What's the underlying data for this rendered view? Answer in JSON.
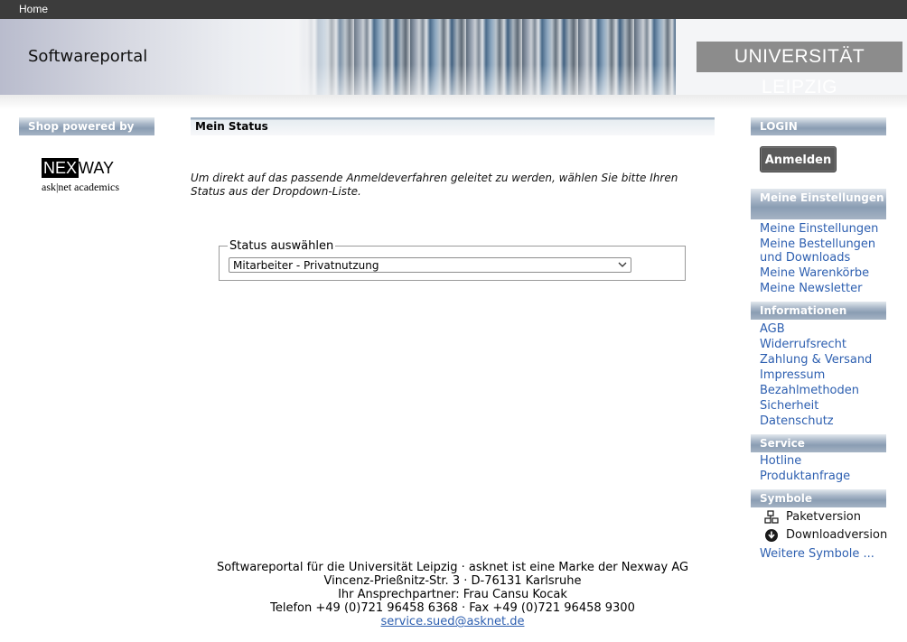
{
  "topbar": {
    "home_label": "Home"
  },
  "header": {
    "title": "Softwareportal",
    "university": "UNIVERSITÄT LEIPZIG"
  },
  "left": {
    "heading": "Shop powered by",
    "logo_nex": "NEX",
    "logo_way": "WAY",
    "logo_sub": "ask|net academics"
  },
  "main": {
    "heading": "Mein Status",
    "intro": "Um direkt auf das passende Anmeldeverfahren geleitet zu werden, wählen Sie bitte Ihren Status aus der Dropdown-Liste.",
    "status_legend": "Status auswählen",
    "status_selected": "Mitarbeiter - Privatnutzung"
  },
  "sidebar": {
    "login": {
      "heading": "LOGIN",
      "button": "Anmelden"
    },
    "einstellungen": {
      "heading": "Meine Einstellungen",
      "links": [
        "Meine Einstellungen",
        "Meine Bestellungen und Downloads",
        "Meine Warenkörbe",
        "Meine Newsletter"
      ]
    },
    "informationen": {
      "heading": "Informationen",
      "links": [
        "AGB",
        "Widerrufsrecht",
        "Zahlung & Versand",
        "Impressum",
        "Bezahlmethoden",
        "Sicherheit",
        "Datenschutz"
      ]
    },
    "service": {
      "heading": "Service",
      "links": [
        "Hotline",
        "Produktanfrage"
      ]
    },
    "symbole": {
      "heading": "Symbole",
      "items": [
        {
          "icon": "package-icon",
          "label": "Paketversion"
        },
        {
          "icon": "download-icon",
          "label": "Downloadversion"
        }
      ],
      "more_link": "Weitere Symbole ..."
    }
  },
  "footer": {
    "line1": "Softwareportal für die Universität Leipzig · asknet ist eine Marke der Nexway AG",
    "line2": "Vincenz-Prießnitz-Str. 3 · D-76131 Karlsruhe",
    "line3": "Ihr Ansprechpartner: Frau Cansu Kocak",
    "line4": "Telefon +49 (0)721 96458 6368 · Fax +49 (0)721 96458 9300",
    "email": "service.sued@asknet.de"
  }
}
